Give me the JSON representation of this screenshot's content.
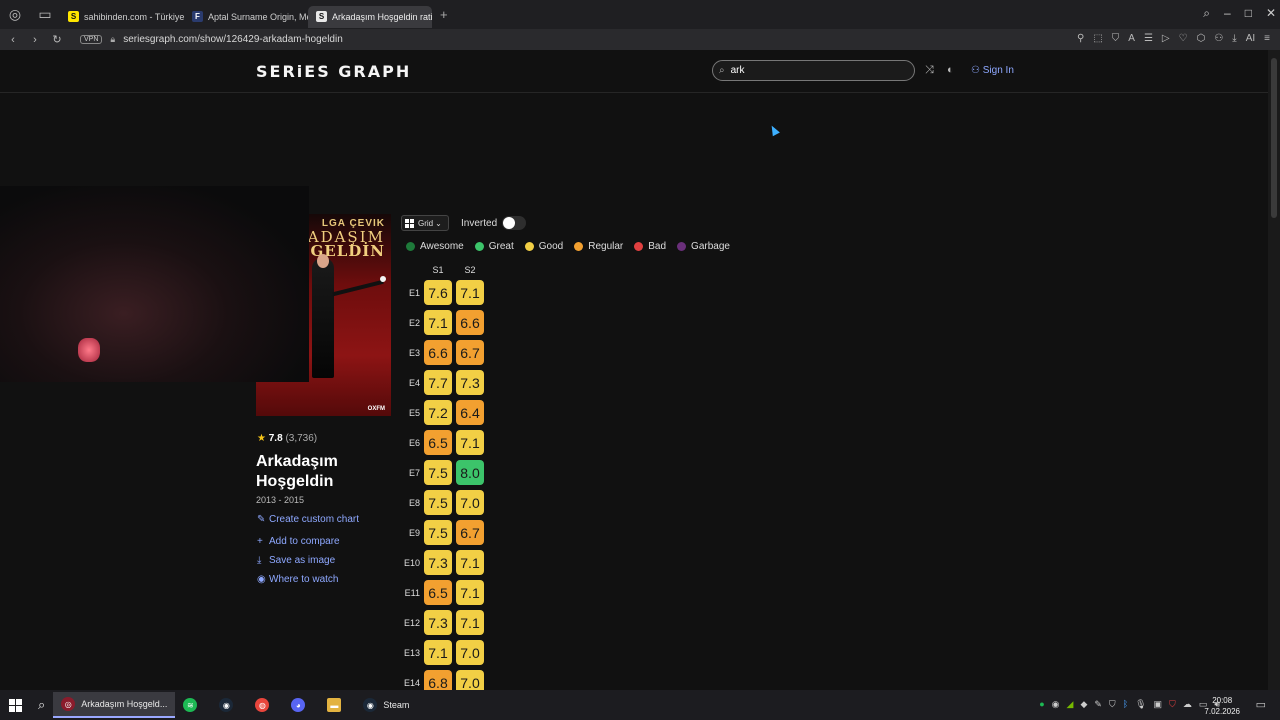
{
  "browser": {
    "tabs": [
      {
        "label": "sahibinden.com - Türkiye'n",
        "fav": "S",
        "fav_color": "#ffe600",
        "fav_text_color": "#111111",
        "active": false
      },
      {
        "label": "Aptal Surname Origin, Mea",
        "fav": "F",
        "fav_color": "#2a3b6e",
        "fav_text_color": "#ffffff",
        "active": false
      },
      {
        "label": "Arkadaşım Hoşgeldin ratin",
        "fav": "S",
        "fav_color": "#e8e8e8",
        "fav_text_color": "#111111",
        "active": true
      }
    ],
    "new_tab": "+",
    "vpn": "VPN",
    "url": "seriesgraph.com/show/126429-arkadam-hogeldin",
    "ai_label": "AI"
  },
  "site": {
    "logo": "SERiES GRAPH",
    "search_value": "ark",
    "sign_in": "Sign In"
  },
  "show": {
    "poster_top": "LGA ÇEVIK",
    "poster_title1": "ADAŞIM",
    "poster_title2": "GELDİN",
    "poster_brand": "OXFM",
    "rating_value": "7.8",
    "rating_count": "(3,736)",
    "title": "Arkadaşım Hoşgeldin",
    "years": "2013 - 2015",
    "actions": [
      {
        "label": "Create custom chart",
        "icon": "pencil-icon",
        "glyph": "✎"
      },
      {
        "label": "Add to compare",
        "icon": "plus-icon",
        "glyph": "+"
      },
      {
        "label": "Save as image",
        "icon": "download-icon",
        "glyph": "⤓"
      },
      {
        "label": "Where to watch",
        "icon": "eye-icon",
        "glyph": "◉"
      }
    ]
  },
  "controls": {
    "view_label": "Grid",
    "inverted_label": "Inverted",
    "inverted_on": false
  },
  "legend": [
    {
      "label": "Awesome",
      "color": "#1e7a3a"
    },
    {
      "label": "Great",
      "color": "#3cc46a"
    },
    {
      "label": "Good",
      "color": "#f2cf45"
    },
    {
      "label": "Regular",
      "color": "#f2a030"
    },
    {
      "label": "Bad",
      "color": "#e04040"
    },
    {
      "label": "Garbage",
      "color": "#6a2f7a"
    }
  ],
  "chart_data": {
    "type": "heatmap",
    "columns": [
      "S1",
      "S2"
    ],
    "rows": [
      "E1",
      "E2",
      "E3",
      "E4",
      "E5",
      "E6",
      "E7",
      "E8",
      "E9",
      "E10",
      "E11",
      "E12",
      "E13",
      "E14"
    ],
    "values": [
      [
        "7.6",
        "7.1"
      ],
      [
        "7.1",
        "6.6"
      ],
      [
        "6.6",
        "6.7"
      ],
      [
        "7.7",
        "7.3"
      ],
      [
        "7.2",
        "6.4"
      ],
      [
        "6.5",
        "7.1"
      ],
      [
        "7.5",
        "8.0"
      ],
      [
        "7.5",
        "7.0"
      ],
      [
        "7.5",
        "6.7"
      ],
      [
        "7.3",
        "7.1"
      ],
      [
        "6.5",
        "7.1"
      ],
      [
        "7.3",
        "7.1"
      ],
      [
        "7.1",
        "7.0"
      ],
      [
        "6.8",
        "7.0"
      ]
    ],
    "colors": {
      "good": "#f2cf45",
      "regular": "#f2a030",
      "great": "#3cc46a"
    }
  },
  "taskbar": {
    "active_window": "Arkadaşım Hoşgeld...",
    "steam": "Steam",
    "time": "20:08",
    "date": "7.02.2026"
  }
}
